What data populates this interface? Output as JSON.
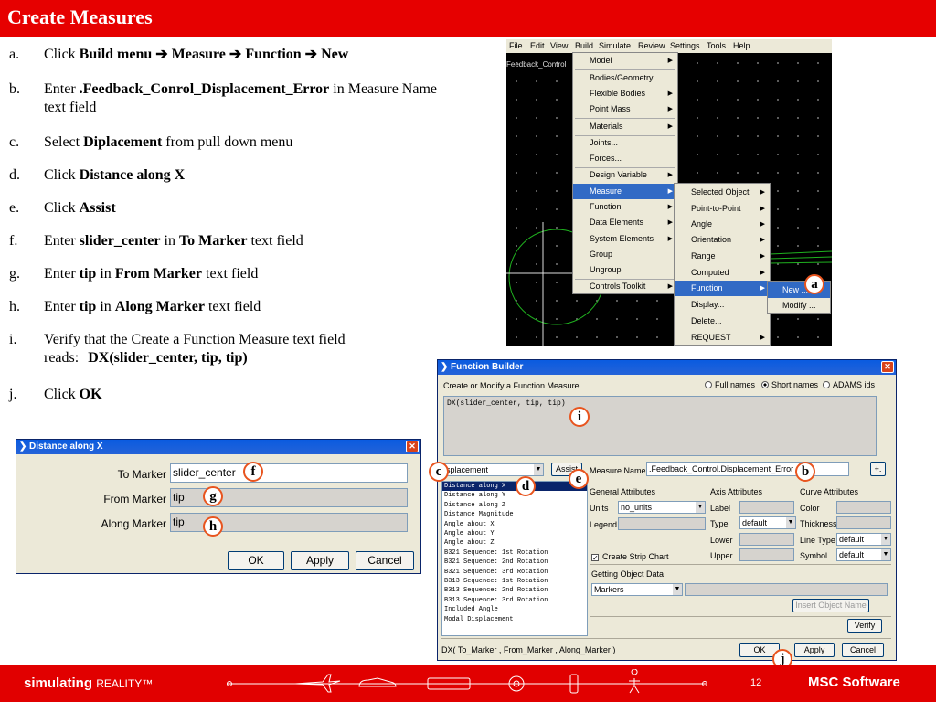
{
  "slide": {
    "title": "Create Measures",
    "page_number": "12",
    "footer_brand": "simulating",
    "footer_brand_suffix": "REALITY™",
    "footer_logo": "MSC Software"
  },
  "steps": [
    {
      "letter": "a.",
      "parts": [
        {
          "t": "Click ",
          "b": false
        },
        {
          "t": "Build menu ➔ Measure ➔ Function ➔ New",
          "b": true
        }
      ]
    },
    {
      "letter": "b.",
      "parts": [
        {
          "t": "Enter ",
          "b": false
        },
        {
          "t": ".Feedback_Conrol_Displacement_Error",
          "b": true
        },
        {
          "t": " in Measure Name text field",
          "b": false
        }
      ]
    },
    {
      "letter": "c.",
      "parts": [
        {
          "t": "Select ",
          "b": false
        },
        {
          "t": "Diplacement",
          "b": true
        },
        {
          "t": " from pull down menu",
          "b": false
        }
      ]
    },
    {
      "letter": "d.",
      "parts": [
        {
          "t": "Click ",
          "b": false
        },
        {
          "t": "Distance along X",
          "b": true
        }
      ]
    },
    {
      "letter": "e.",
      "parts": [
        {
          "t": "Click ",
          "b": false
        },
        {
          "t": "Assist",
          "b": true
        }
      ]
    },
    {
      "letter": "f.",
      "parts": [
        {
          "t": "Enter ",
          "b": false
        },
        {
          "t": "slider_center",
          "b": true
        },
        {
          "t": " in ",
          "b": false
        },
        {
          "t": "To Marker",
          "b": true
        },
        {
          "t": " text field",
          "b": false
        }
      ]
    },
    {
      "letter": "g.",
      "parts": [
        {
          "t": "Enter ",
          "b": false
        },
        {
          "t": "tip",
          "b": true
        },
        {
          "t": " in ",
          "b": false
        },
        {
          "t": "From Marker",
          "b": true
        },
        {
          "t": " text field",
          "b": false
        }
      ]
    },
    {
      "letter": "h.",
      "parts": [
        {
          "t": "Enter ",
          "b": false
        },
        {
          "t": "tip",
          "b": true
        },
        {
          "t": " in ",
          "b": false
        },
        {
          "t": "Along Marker",
          "b": true
        },
        {
          "t": " text field",
          "b": false
        }
      ]
    },
    {
      "letter": "i.",
      "parts": [
        {
          "t": "Verify that the Create a Function Measure text field reads:",
          "b": false
        }
      ],
      "formula": "DX(slider_center, tip, tip)"
    },
    {
      "letter": "j.",
      "parts": [
        {
          "t": "Click ",
          "b": false
        },
        {
          "t": "OK",
          "b": true
        }
      ]
    }
  ],
  "menu": {
    "menubar": [
      "File",
      "Edit",
      "View",
      "Build",
      "Simulate",
      "Review",
      "Settings",
      "Tools",
      "Help"
    ],
    "canvas_label": "Feedback_Control",
    "build_items": [
      "Model",
      "Bodies/Geometry...",
      "Flexible Bodies",
      "Point Mass",
      "Materials",
      "Joints...",
      "Forces...",
      "Design Variable",
      "Measure",
      "Function",
      "Data Elements",
      "System Elements",
      "Group",
      "Ungroup",
      "Controls Toolkit"
    ],
    "measure_items": [
      "Selected Object",
      "Point-to-Point",
      "Angle",
      "Orientation",
      "Range",
      "Computed",
      "Function",
      "Display...",
      "Delete...",
      "REQUEST"
    ],
    "function_items": [
      "New ...",
      "Modify ..."
    ]
  },
  "distance_dialog": {
    "title": "Distance along X",
    "to_marker_label": "To Marker",
    "to_marker_value": "slider_center",
    "from_marker_label": "From Marker",
    "from_marker_value": "tip",
    "along_marker_label": "Along Marker",
    "along_marker_value": "tip",
    "ok": "OK",
    "apply": "Apply",
    "cancel": "Cancel"
  },
  "function_builder": {
    "title": "Function Builder",
    "heading": "Create or Modify a Function Measure",
    "name_options": [
      "Full names",
      "Short names",
      "ADAMS ids"
    ],
    "selected_name_option": "Short names",
    "expression": "DX(slider_center, tip, tip)",
    "category_value": "isplacement",
    "assist_label": "Assist",
    "measure_name_label": "Measure Name",
    "measure_name_value": ".Feedback_Control.Displacement_Error",
    "plus_label": "+.",
    "functions": [
      "Distance along X",
      "Distance along Y",
      "Distance along Z",
      "Distance Magnitude",
      "Angle about X",
      "Angle about Y",
      "Angle about Z",
      "B321 Sequence: 1st Rotation",
      "B321 Sequence: 2nd Rotation",
      "B321 Sequence: 3rd Rotation",
      "B313 Sequence: 1st Rotation",
      "B313 Sequence: 2nd Rotation",
      "B313 Sequence: 3rd Rotation",
      "Included Angle",
      "Modal Displacement"
    ],
    "general_attributes": "General Attributes",
    "units_label": "Units",
    "units_value": "no_units",
    "legend_label": "Legend",
    "axis_attributes": "Axis Attributes",
    "label_label": "Label",
    "type_label": "Type",
    "type_value": "default",
    "lower_label": "Lower",
    "upper_label": "Upper",
    "curve_attributes": "Curve Attributes",
    "color_label": "Color",
    "thickness_label": "Thickness",
    "line_type_label": "Line Type",
    "line_type_value": "default",
    "symbol_label": "Symbol",
    "symbol_value": "default",
    "strip_chart_label": "Create Strip Chart",
    "object_data_label": "Getting Object Data",
    "object_data_value": "Markers",
    "insert_object_name": "Insert Object Name",
    "verify": "Verify",
    "status": "DX( To_Marker , From_Marker , Along_Marker )",
    "ok": "OK",
    "apply": "Apply",
    "cancel": "Cancel"
  },
  "callouts": [
    "a",
    "b",
    "c",
    "d",
    "e",
    "f",
    "g",
    "h",
    "i",
    "j"
  ]
}
